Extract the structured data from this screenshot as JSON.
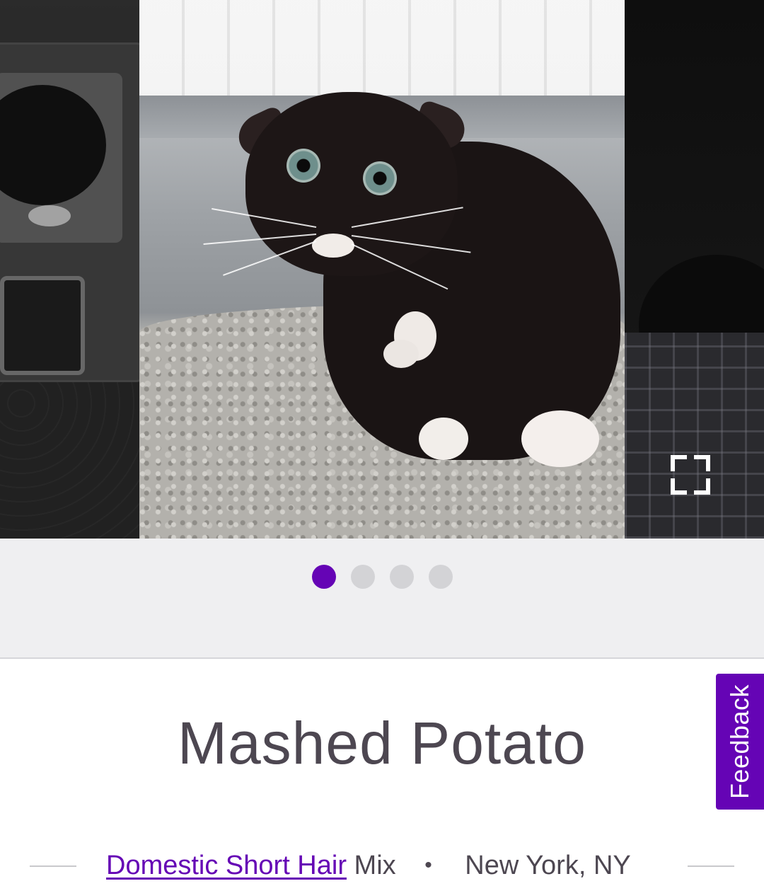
{
  "carousel": {
    "slide_count": 4,
    "active_index": 0,
    "fullscreen_icon": "fullscreen-icon"
  },
  "pet": {
    "name": "Mashed Potato",
    "breed_link": "Domestic Short Hair",
    "breed_suffix": "Mix",
    "separator": "•",
    "location": "New York, NY"
  },
  "feedback": {
    "label": "Feedback"
  },
  "colors": {
    "accent": "#6504b5",
    "text": "#4d4751",
    "dot_inactive": "#d3d3d6",
    "band_bg": "#efeff1"
  }
}
